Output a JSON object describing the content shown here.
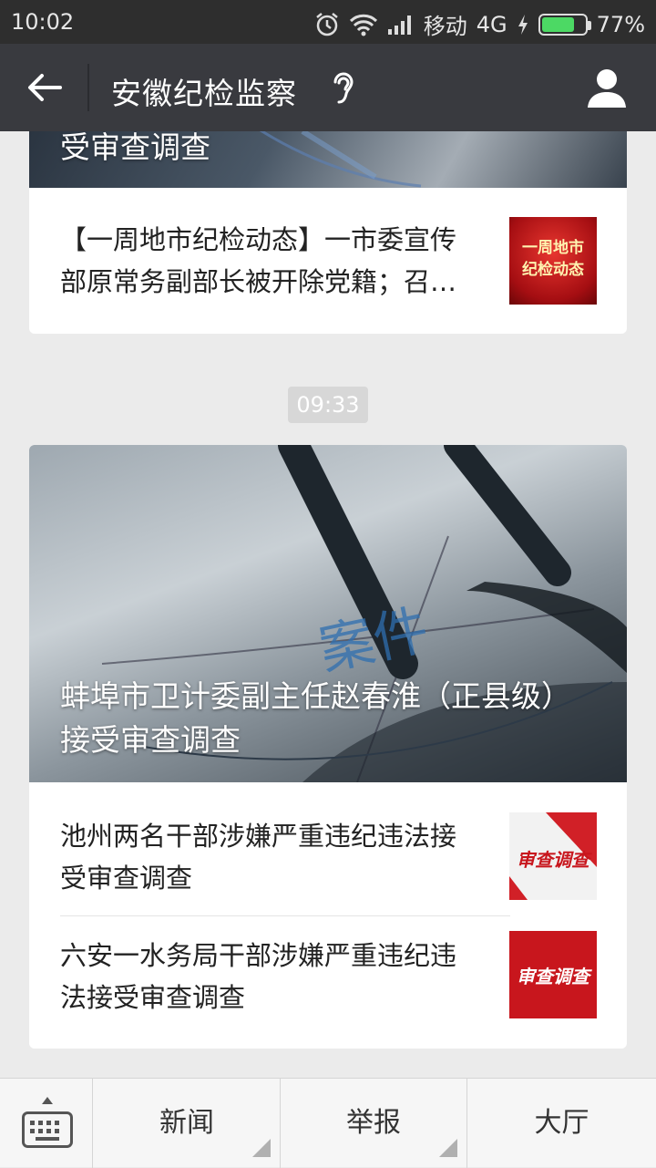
{
  "status_bar": {
    "time": "10:02",
    "carrier": "移动",
    "network": "4G",
    "battery": "77%",
    "battery_level": 0.77
  },
  "nav": {
    "title": "安徽纪检监察"
  },
  "cards": [
    {
      "cover_title": "受审查调查",
      "items": [
        {
          "text": "【一周地市纪检动态】一市委宣传部原常务副部长被开除党籍；召…",
          "thumb_text": "一周地市纪检动态"
        }
      ]
    },
    {
      "cover_title": "蚌埠市卫计委副主任赵春淮（正县级）接受审查调查",
      "cover_overlay": "案件",
      "items": [
        {
          "text": "池州两名干部涉嫌严重违纪违法接受审查调查",
          "thumb_text": "审查调查"
        },
        {
          "text": "六安一水务局干部涉嫌严重违纪违法接受审查调查",
          "thumb_text": "审查调查"
        }
      ]
    }
  ],
  "timestamp": "09:33",
  "bottom_menu": {
    "items": [
      "新闻",
      "举报",
      "大厅"
    ]
  },
  "colors": {
    "nav_bg": "#393a3f",
    "status_bg": "#2e2e2e",
    "page_bg": "#ebebeb",
    "thumb_red": "#c8161d"
  }
}
